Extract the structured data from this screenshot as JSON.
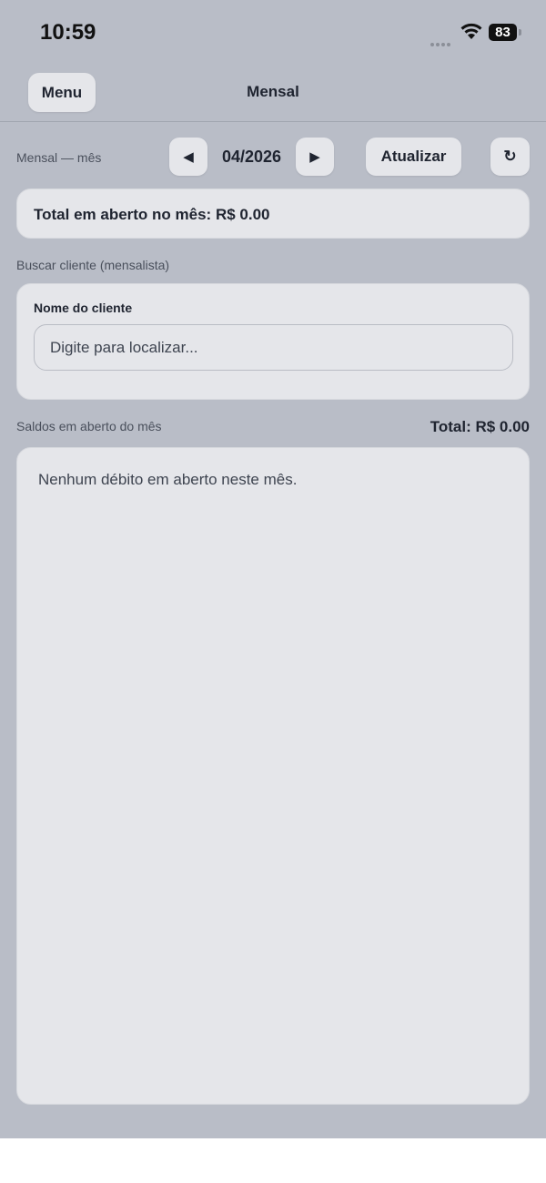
{
  "status_bar": {
    "time": "10:59",
    "battery": "83"
  },
  "nav": {
    "menu_label": "Menu",
    "title": "Mensal"
  },
  "month_controls": {
    "label": "Mensal — mês",
    "prev_glyph": "◀",
    "month": "04/2026",
    "next_glyph": "▶",
    "update_label": "Atualizar",
    "refresh_glyph": "↻"
  },
  "summary": {
    "total_open": "Total em aberto no mês: R$ 0.00"
  },
  "search": {
    "section_label": "Buscar cliente (mensalista)",
    "field_label": "Nome do cliente",
    "placeholder": "Digite para localizar...",
    "value": ""
  },
  "balances": {
    "section_label": "Saldos em aberto do mês",
    "total": "Total: R$ 0.00",
    "empty_message": "Nenhum débito em aberto neste mês."
  },
  "colors": {
    "background": "#b9bdc7",
    "card": "#e5e6ea",
    "text": "#1f2430"
  },
  "icons": [
    "wifi-icon",
    "battery-icon",
    "signal-icon",
    "prev-arrow-icon",
    "next-arrow-icon",
    "refresh-icon"
  ]
}
